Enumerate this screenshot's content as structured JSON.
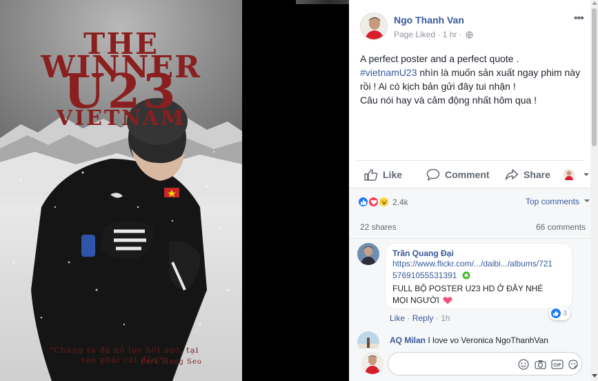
{
  "poster": {
    "line1": "THE",
    "line2": "WINNER",
    "line3": "U23",
    "line4": "VIETNAM",
    "quote": "\"Chúng ta đã nỗ lực hết sức, tại sao phải cúi đầu?\"",
    "author": "Park Hang Seo"
  },
  "post": {
    "author": "Ngo Thanh Van",
    "meta": "Page Liked · 1 hr ·",
    "text_line1": "A perfect poster and a perfect quote .",
    "hashtag": "#vietnamU23",
    "text_line2_rest": " nhìn là muốn sản xuất ngay phim này",
    "text_line3": "rồi ! Ai có kịch bản gửi đây tui nhận !",
    "text_line4": "Câu nói hay và cảm động nhất hôm qua !"
  },
  "actions": {
    "like": "Like",
    "comment": "Comment",
    "share": "Share"
  },
  "stats": {
    "reactions": "2.4k",
    "top_comments": "Top comments",
    "shares": "22 shares",
    "comments": "66 comments"
  },
  "comments": [
    {
      "name": "Trần Quang Đại",
      "link_line1": "https://www.flickr.com/.../daibi.../albums/721",
      "link_line2": "57691055531391",
      "text_line1": "FULL BỘ POSTER U23 HD Ở ĐÂY NHÉ",
      "text_line2": "MỌI NGƯỜI",
      "like_label": "Like",
      "reply_label": "Reply",
      "time": "1h",
      "likes": "3"
    },
    {
      "name": "AQ Milan",
      "text": "I love vo Veronica NgoThanhVan"
    }
  ],
  "composer": {
    "placeholder": ""
  },
  "colors": {
    "link": "#365899",
    "poster_red": "#8a1f1f",
    "like_blue": "#2078f4",
    "love_red": "#f33e58"
  },
  "icons": [
    "more-icon",
    "globe-icon",
    "like-icon",
    "comment-icon",
    "share-icon",
    "reaction-like-icon",
    "reaction-love-icon",
    "reaction-haha-icon",
    "heart-emoji-icon",
    "emoji-icon",
    "camera-icon",
    "gif-icon",
    "sticker-icon"
  ]
}
